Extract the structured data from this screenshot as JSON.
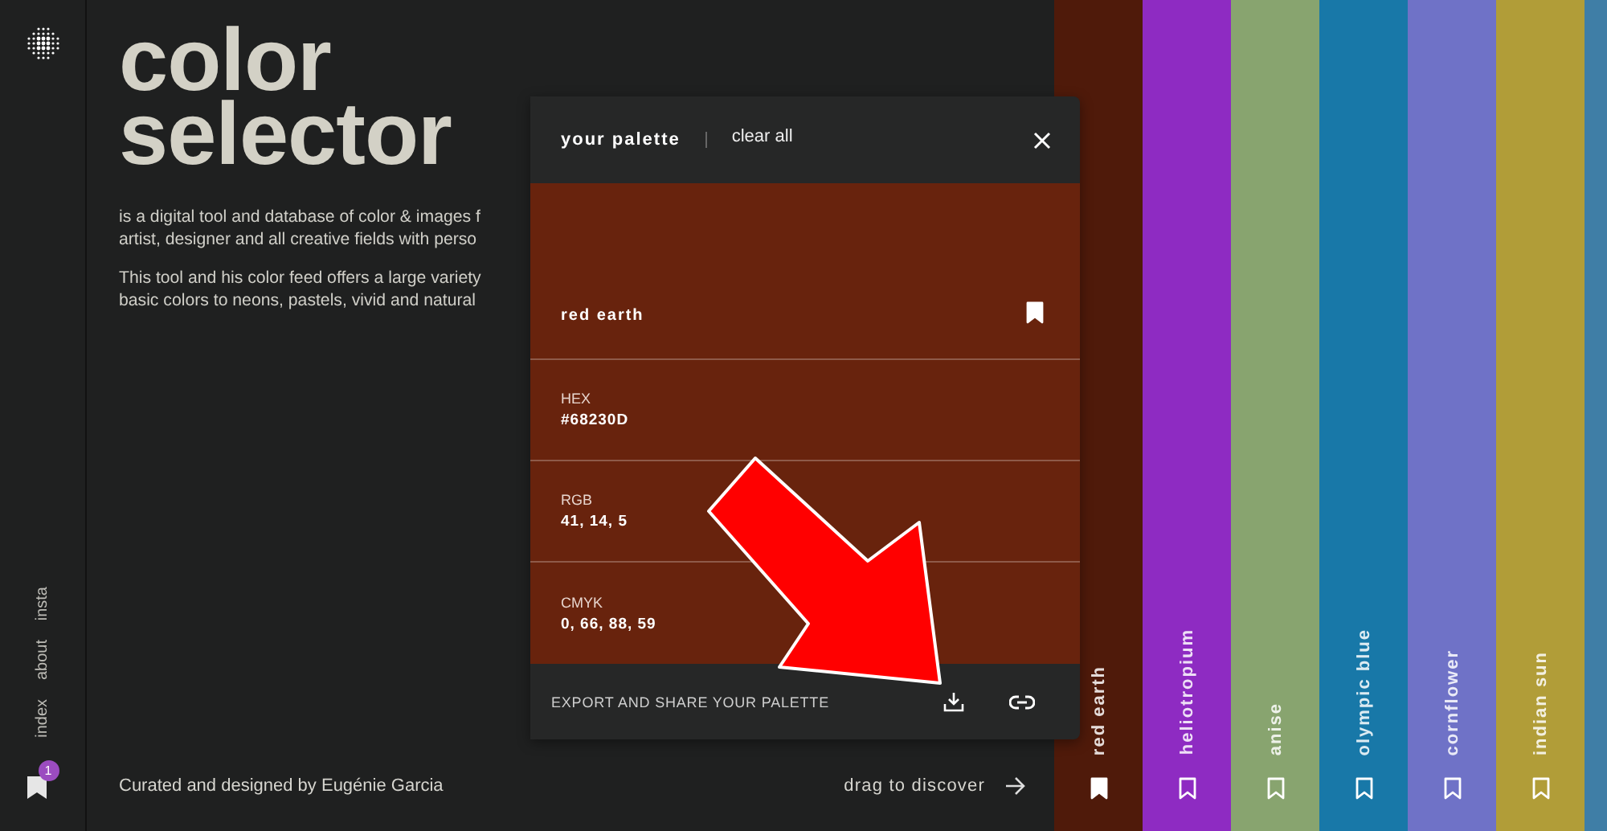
{
  "sidebar": {
    "nav": [
      "insta",
      "about",
      "index"
    ],
    "saved_count": "1"
  },
  "hero": {
    "title_lines": [
      "color",
      "selector"
    ],
    "paragraphs": [
      [
        "is a digital tool and database of color & images f",
        "artist, designer and all creative fields with perso"
      ],
      [
        "This tool and his color feed offers a large variety",
        "basic colors to neons, pastels, vivid and natural"
      ]
    ]
  },
  "footer": {
    "credit": "Curated and designed by Eugénie Garcia",
    "drag_label": "drag to discover"
  },
  "strips": [
    {
      "name": "red earth",
      "color": "#4f1a0a",
      "bookmarked": true
    },
    {
      "name": "heliotropium",
      "color": "#8e2bc2",
      "bookmarked": false
    },
    {
      "name": "anise",
      "color": "#88a46f",
      "bookmarked": false
    },
    {
      "name": "olympic blue",
      "color": "#1878a8",
      "bookmarked": false
    },
    {
      "name": "cornflower",
      "color": "#6f72c7",
      "bookmarked": false
    },
    {
      "name": "indian sun",
      "color": "#b19d38",
      "bookmarked": false
    },
    {
      "color": "#3f7ea6"
    }
  ],
  "palette": {
    "title": "your palette",
    "clear_label": "clear all",
    "swatch": {
      "name": "red earth",
      "color": "#68230d",
      "bookmarked": true
    },
    "specs": [
      {
        "label": "HEX",
        "value": "#68230D"
      },
      {
        "label": "RGB",
        "value": "41, 14, 5"
      },
      {
        "label": "CMYK",
        "value": "0, 66, 88, 59"
      }
    ],
    "footer": "EXPORT AND SHARE YOUR PALETTE"
  }
}
